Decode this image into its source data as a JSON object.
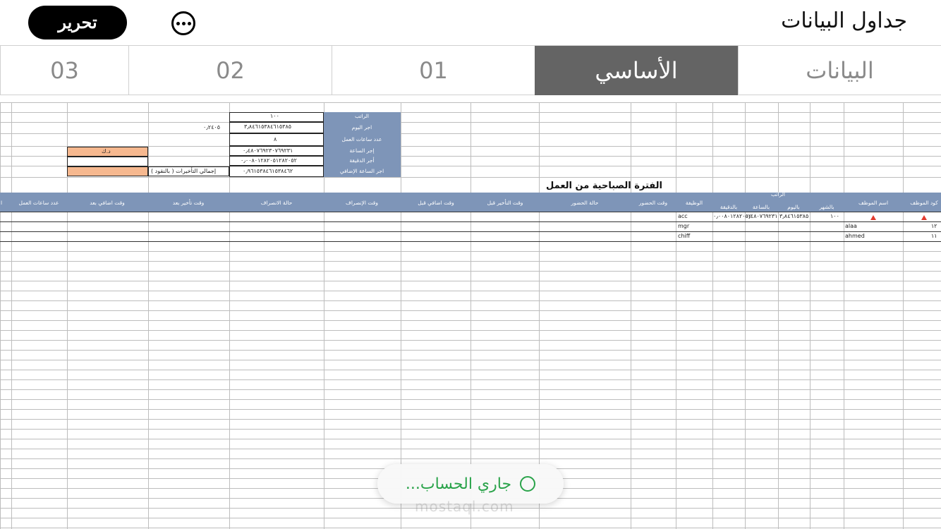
{
  "header": {
    "title": "جداول البيانات",
    "edit_label": "تحرير",
    "more_icon": "ellipsis-circle-icon"
  },
  "tabs": [
    {
      "label": "البيانات",
      "active": false
    },
    {
      "label": "الأساسي",
      "active": true
    },
    {
      "label": "01",
      "active": false
    },
    {
      "label": "02",
      "active": false
    },
    {
      "label": "03",
      "active": false
    }
  ],
  "summary": {
    "labels": [
      "الراتب",
      "اجر اليوم",
      "عدد ساعات العمل",
      "إجر الساعة",
      "أجر الدقيقة",
      "اجر الساعة الإضافي"
    ],
    "values": [
      "١٠٠",
      "٣٫٨٤٦١٥٣٨٤٦١٥٣٨٥",
      "٨",
      "٠٫٤٨٠٧٦٩٢٣٠٧٦٩٢٣١",
      "٠٫٠٠٨٠١٢٨٢٠٥١٢٨٢٠٥٢",
      "٠٫٩٦١٥٣٨٤٦١٥٣٨٤٦٢"
    ],
    "side_value": "٠٫٢٤٠٥",
    "currency": "د.ك",
    "delay_total_label": "إجمالي التأخيرات ( بالنقود )"
  },
  "section_title": "الفترة الصباحية من العمل",
  "table": {
    "columns": [
      "كود الموظف",
      "اسم الموظف",
      "الراتب",
      "الوظيفة",
      "وقت الحضور",
      "حالة الحضور",
      "وقت التأخير قبل",
      "وقت اضافي قبل",
      "وقت الإنصراف",
      "حالة الانصراف",
      "وقت تأخير بعد",
      "وقت اضافي بعد",
      "عدد ساعات العمل",
      "ا"
    ],
    "salary_sub": [
      "بالشهر",
      "باليوم",
      "بالساعة",
      "بالدقيقة"
    ],
    "rows": [
      {
        "code": "",
        "name": "",
        "job": "acc",
        "monthly": "١٠٠",
        "daily": "٣٫٨٤٦١٥٣٨٥",
        "hourly": "٠٫٤٨٠٧٦٩٢٣١",
        "minute": "٠٫٠٠٨٠١٢٨٢٠٥٢"
      },
      {
        "code": "١٢",
        "name": "alaa",
        "job": "mgr",
        "monthly": "",
        "daily": "",
        "hourly": "",
        "minute": ""
      },
      {
        "code": "١١",
        "name": "ahmed",
        "job": "chiff",
        "monthly": "",
        "daily": "",
        "hourly": "",
        "minute": ""
      }
    ]
  },
  "toast": {
    "text": "جاري الحساب...",
    "watermark": "mostaql.com"
  }
}
